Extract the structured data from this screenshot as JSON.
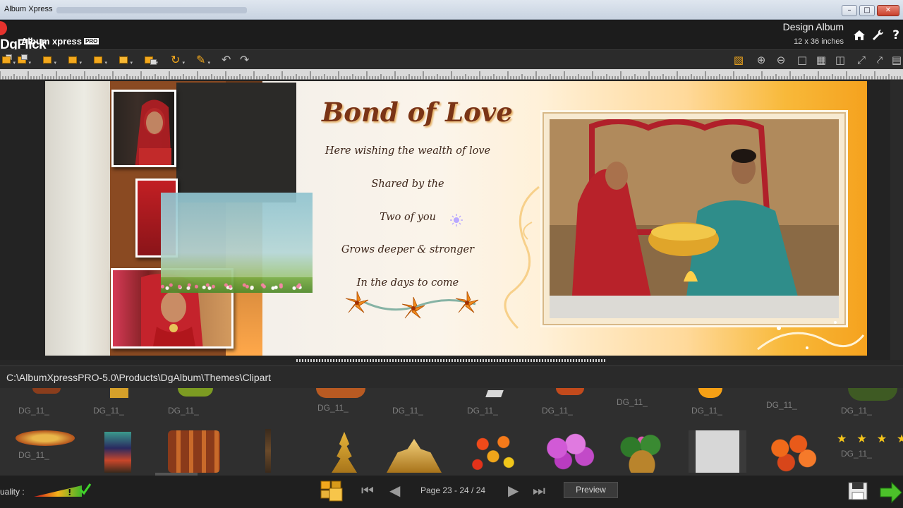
{
  "window": {
    "title": "Album Xpress"
  },
  "header": {
    "brand": "DgFlick",
    "product": "Album xpress",
    "edition": "PRO",
    "mode_title": "Design Album",
    "album_size": "12 x 36 inches",
    "icons": [
      "home-icon",
      "wrench-icon",
      "help-icon"
    ]
  },
  "toolbar": {
    "left_icons": [
      "bring-to-front-icon",
      "send-backward-icon",
      "align-left-icon",
      "align-top-icon",
      "align-bottom-icon",
      "distribute-icon",
      "group-icon",
      "rotate-icon",
      "brush-icon",
      "undo-icon",
      "redo-icon"
    ],
    "right_icons": [
      "snap-icon",
      "zoom-in-icon",
      "zoom-out-icon",
      "fit-page-icon",
      "grid-icon",
      "split-view-icon",
      "fit-width-icon",
      "fit-height-icon",
      "more-icon"
    ]
  },
  "album_page": {
    "title": "Bond of Love",
    "poem_lines": [
      "Here wishing the wealth of love",
      "Shared by the",
      "Two of you",
      "Grows deeper & stronger",
      "In the days to come"
    ]
  },
  "clipart": {
    "path": "C:\\AlbumXpressPRO-5.0\\Products\\DgAlbum\\Themes\\Clipart",
    "row1_labels": [
      "DG_11_",
      "DG_11_",
      "DG_11_",
      "DG_11_",
      "DG_11_",
      "DG_11_",
      "DG_11_",
      "DG_11_",
      "DG_11_",
      "DG_11_",
      "DG_11_",
      "DG_11_"
    ],
    "row2_labels": [
      "DG_11_",
      "DG_11_"
    ]
  },
  "bottom": {
    "quality_label": "uality :",
    "page_info": "Page 23 - 24 / 24",
    "preview_label": "Preview"
  },
  "colors": {
    "accent_orange": "#f3a81d",
    "title_brown": "#7a3416",
    "next_arrow_green": "#4cc02a"
  }
}
